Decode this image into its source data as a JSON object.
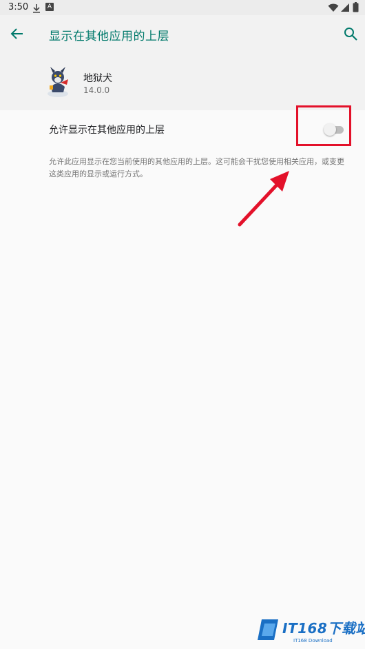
{
  "status_bar": {
    "time": "3:50",
    "icons": [
      "download-icon",
      "a-notification-icon",
      "wifi-icon",
      "signal-icon",
      "battery-icon"
    ],
    "a_label": "A"
  },
  "app_bar": {
    "title": "显示在其他应用的上层",
    "back_icon": "back-arrow-icon",
    "search_icon": "search-icon",
    "accent_color": "#00796b"
  },
  "app_header": {
    "name": "地狱犬",
    "version": "14.0.0",
    "icon": "app-icon"
  },
  "setting": {
    "label": "允许显示在其他应用的上层",
    "enabled": false,
    "description": "允许此应用显示在您当前使用的其他应用的上层。这可能会干扰您使用相关应用，或变更这类应用的显示或运行方式。"
  },
  "annotation": {
    "highlight_color": "#e3112a"
  },
  "watermark": {
    "text": "IT168下载站",
    "subtext": "IT168 Download"
  }
}
